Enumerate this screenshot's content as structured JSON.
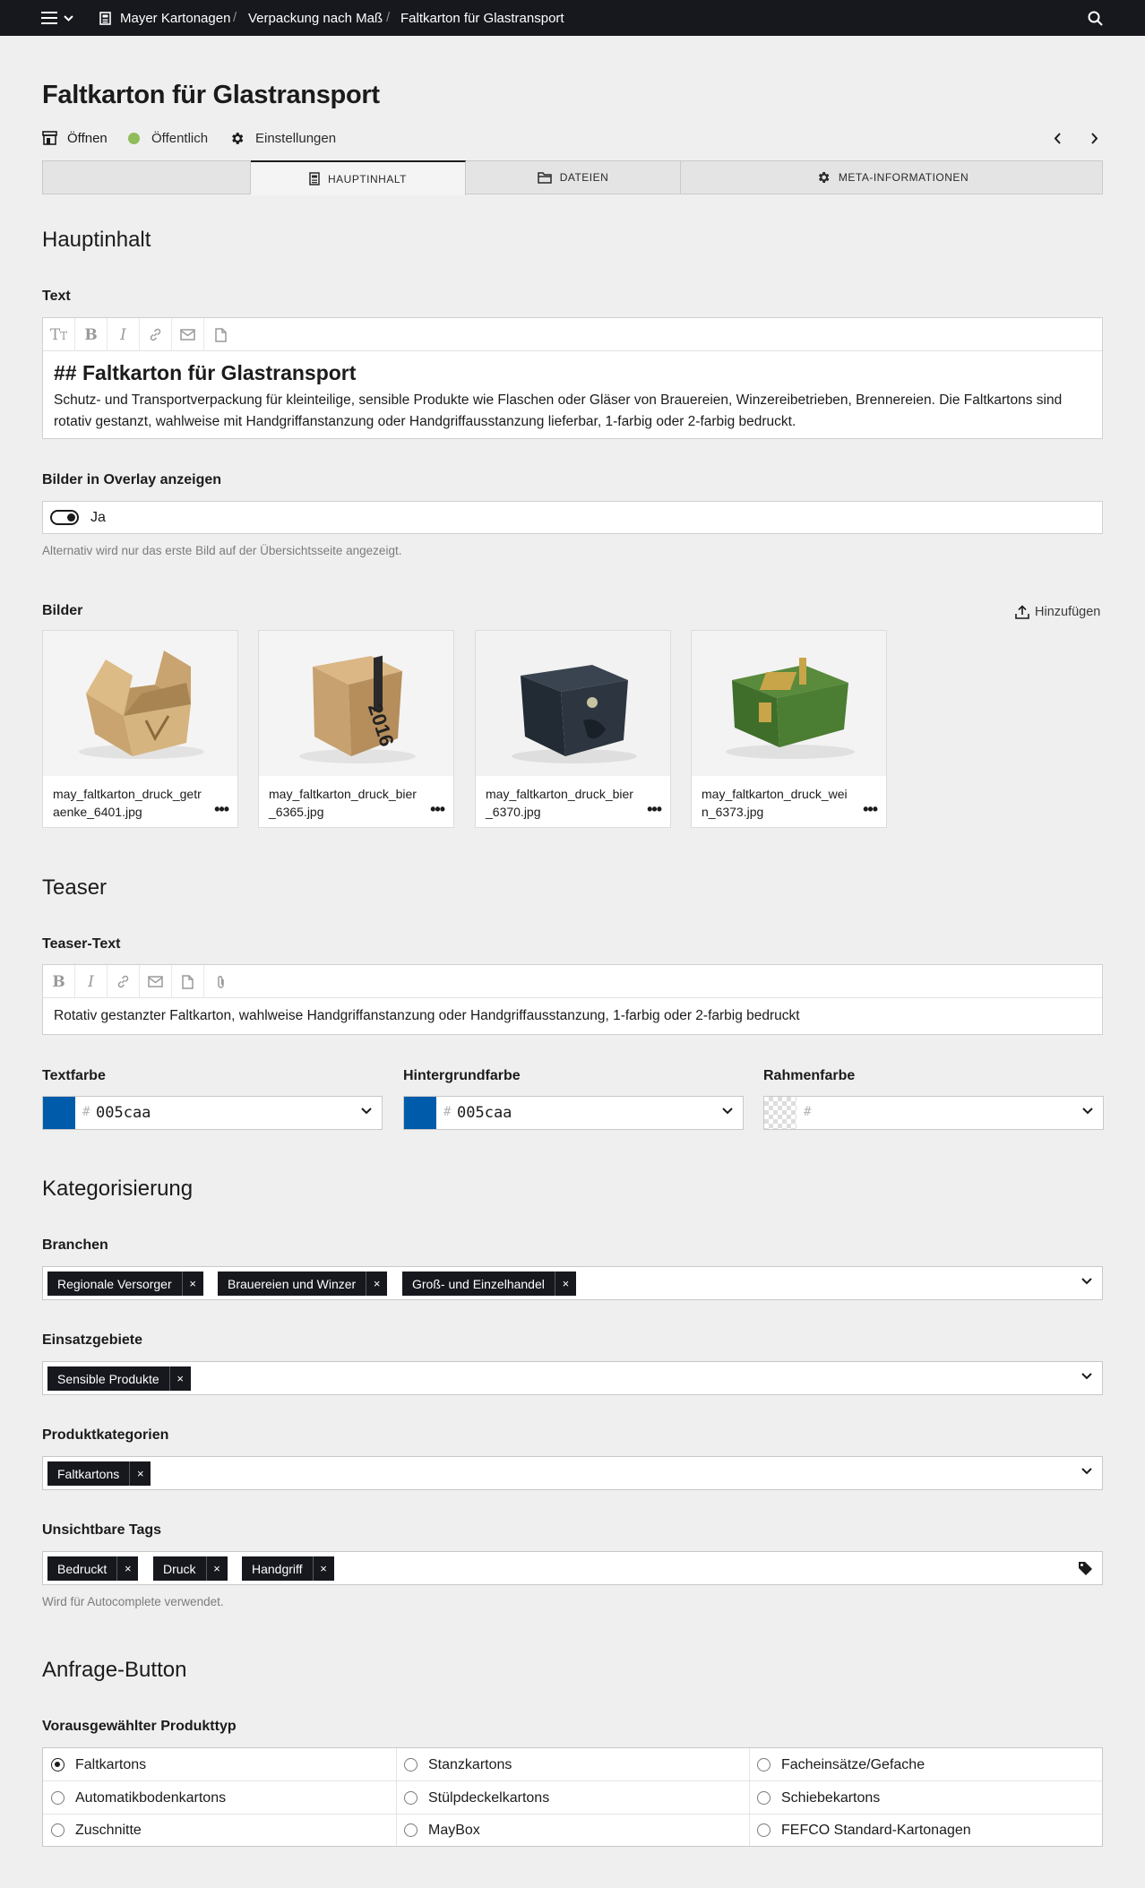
{
  "topbar": {
    "breadcrumbs": [
      "Mayer Kartonagen",
      "Verpackung nach Maß",
      "Faltkarton für Glastransport"
    ],
    "separator": "/"
  },
  "page": {
    "title": "Faltkarton für Glastransport",
    "actions": {
      "open": "Öffnen",
      "status": "Öffentlich",
      "settings": "Einstellungen"
    },
    "status_color": "#8fbd5a"
  },
  "tabs": [
    {
      "label": "HAUPTINHALT",
      "icon": "document-icon",
      "active": true
    },
    {
      "label": "DATEIEN",
      "icon": "folder-icon",
      "active": false
    },
    {
      "label": "META-INFORMATIONEN",
      "icon": "gear-icon",
      "active": false
    }
  ],
  "main": {
    "section_title": "Hauptinhalt",
    "text": {
      "label": "Text",
      "heading": "## Faltkarton für Glastransport",
      "body": "Schutz- und Transportverpackung für kleinteilige, sensible Produkte wie Flaschen oder Gläser von Brauereien, Winzereibetrieben, Brennereien. Die Faltkartons sind rotativ gestanzt, wahlweise mit Handgriffanstanzung oder Handgriffausstanzung lieferbar, 1-farbig oder 2-farbig bedruckt."
    },
    "overlay": {
      "label": "Bilder in Overlay anzeigen",
      "value": "Ja",
      "help": "Alternativ wird nur das erste Bild auf der Übersichtsseite angezeigt."
    },
    "images": {
      "label": "Bilder",
      "add_label": "Hinzufügen",
      "items": [
        {
          "name": "may_faltkarton_druck_getraenke_6401.jpg"
        },
        {
          "name": "may_faltkarton_druck_bier_6365.jpg"
        },
        {
          "name": "may_faltkarton_druck_bier_6370.jpg"
        },
        {
          "name": "may_faltkarton_druck_wein_6373.jpg"
        }
      ],
      "menu_glyph": "•••"
    }
  },
  "teaser": {
    "section_title": "Teaser",
    "text_label": "Teaser-Text",
    "text": "Rotativ gestanzter Faltkarton, wahlweise Handgriffanstanzung oder Handgriffausstanzung, 1-farbig oder 2-farbig bedruckt",
    "colors": [
      {
        "label": "Textfarbe",
        "value": "005caa",
        "swatch": "#005caa"
      },
      {
        "label": "Hintergrundfarbe",
        "value": "005caa",
        "swatch": "#005caa"
      },
      {
        "label": "Rahmenfarbe",
        "value": "",
        "swatch": "transparent"
      }
    ],
    "hash": "#"
  },
  "categorization": {
    "section_title": "Kategorisierung",
    "branchen": {
      "label": "Branchen",
      "tags": [
        "Regionale Versorger",
        "Brauereien und Winzer",
        "Groß- und Einzelhandel"
      ]
    },
    "einsatzgebiete": {
      "label": "Einsatzgebiete",
      "tags": [
        "Sensible Produkte"
      ]
    },
    "produktkategorien": {
      "label": "Produktkategorien",
      "tags": [
        "Faltkartons"
      ]
    },
    "unsichtbare_tags": {
      "label": "Unsichtbare Tags",
      "tags": [
        "Bedruckt",
        "Druck",
        "Handgriff"
      ],
      "help": "Wird für Autocomplete verwendet."
    },
    "remove_glyph": "×"
  },
  "request_button": {
    "section_title": "Anfrage-Button",
    "label": "Vorausgewählter Produkttyp",
    "options": [
      [
        "Faltkartons",
        "Stanzkartons",
        "Facheinsätze/Gefache"
      ],
      [
        "Automatikbodenkartons",
        "Stülpdeckelkartons",
        "Schiebekartons"
      ],
      [
        "Zuschnitte",
        "MayBox",
        "FEFCO Standard-Kartonagen"
      ]
    ],
    "selected": "Faltkartons"
  }
}
